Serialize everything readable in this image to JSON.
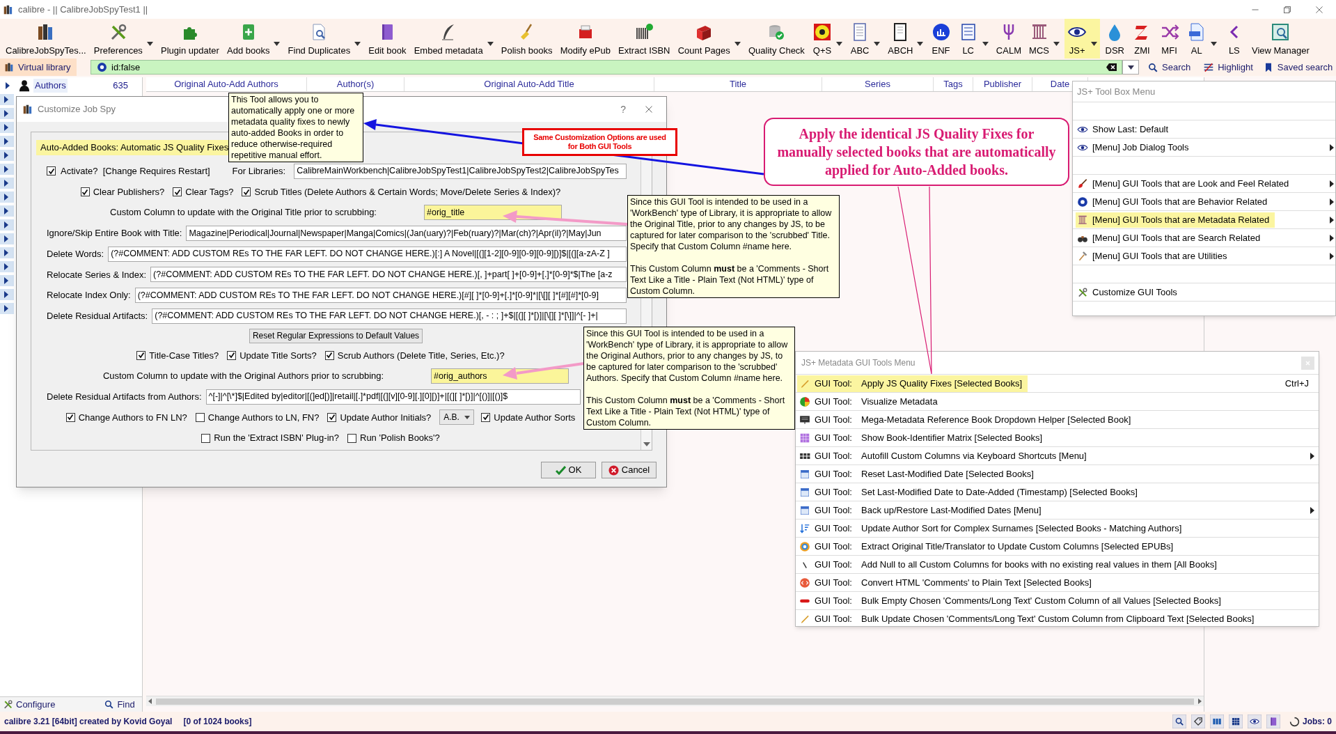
{
  "window": {
    "title": "calibre - || CalibreJobSpyTest1 ||"
  },
  "toolbar": [
    {
      "label": "CalibreJobSpyTes...",
      "dropdown": false,
      "selected": false
    },
    {
      "label": "Preferences",
      "dropdown": true,
      "selected": false
    },
    {
      "label": "Plugin updater",
      "dropdown": false,
      "selected": false
    },
    {
      "label": "Add books",
      "dropdown": true,
      "selected": false
    },
    {
      "label": "Find Duplicates",
      "dropdown": true,
      "selected": false
    },
    {
      "label": "Edit book",
      "dropdown": false,
      "selected": false
    },
    {
      "label": "Embed metadata",
      "dropdown": true,
      "selected": false
    },
    {
      "label": "Polish books",
      "dropdown": false,
      "selected": false
    },
    {
      "label": "Modify ePub",
      "dropdown": false,
      "selected": false
    },
    {
      "label": "Extract ISBN",
      "dropdown": false,
      "selected": false
    },
    {
      "label": "Count Pages",
      "dropdown": true,
      "selected": false
    },
    {
      "label": "Quality Check",
      "dropdown": false,
      "selected": false
    },
    {
      "label": "Q+S",
      "dropdown": true,
      "selected": false
    },
    {
      "label": "ABC",
      "dropdown": true,
      "selected": false
    },
    {
      "label": "ABCH",
      "dropdown": true,
      "selected": false
    },
    {
      "label": "ENF",
      "dropdown": false,
      "selected": false
    },
    {
      "label": "LC",
      "dropdown": true,
      "selected": false
    },
    {
      "label": "CALM",
      "dropdown": false,
      "selected": false
    },
    {
      "label": "MCS",
      "dropdown": true,
      "selected": false
    },
    {
      "label": "JS+",
      "dropdown": true,
      "selected": true
    },
    {
      "label": "DSR",
      "dropdown": false,
      "selected": false
    },
    {
      "label": "ZMI",
      "dropdown": false,
      "selected": false
    },
    {
      "label": "MFI",
      "dropdown": false,
      "selected": false
    },
    {
      "label": "AL",
      "dropdown": true,
      "selected": false
    },
    {
      "label": "LS",
      "dropdown": false,
      "selected": false
    },
    {
      "label": "View Manager",
      "dropdown": false,
      "selected": false
    }
  ],
  "search_bar": {
    "virtual_library": "Virtual library",
    "query": "id:false",
    "search": "Search",
    "highlight": "Highlight",
    "saved_search": "Saved search"
  },
  "tag_browser": {
    "category": "Authors",
    "count": "635",
    "configure": "Configure",
    "find": "Find"
  },
  "table": {
    "columns": [
      "Original Auto-Add Authors",
      "Author(s)",
      "Original Auto-Add Title",
      "Title",
      "Series",
      "Tags",
      "Publisher",
      "Date"
    ]
  },
  "dialog": {
    "title": "Customize Job Spy",
    "help": "?",
    "group_title": "Auto-Added Books: Automatic JS Quality Fixes",
    "rows": [
      {
        "kind": "activate",
        "checked": true,
        "label": "Activate?  [Change Requires Restart]",
        "libraries_label": "For Libraries:",
        "libraries": "CalibreMainWorkbench|CalibreJobSpyTest1|CalibreJobSpyTest2|CalibreJobSpyTes"
      },
      {
        "kind": "checks",
        "items": [
          {
            "kind": "check",
            "label": "Clear Publishers?",
            "checked": true
          },
          {
            "kind": "check",
            "label": "Clear Tags?",
            "checked": true
          },
          {
            "kind": "check",
            "label": "Scrub Titles (Delete Authors & Certain Words; Move/Delete Series & Index)?",
            "checked": true
          }
        ]
      },
      {
        "kind": "custom_column",
        "label": "Custom Column to update with the Original Title prior to scrubbing:",
        "value": "#orig_title"
      },
      {
        "kind": "regex",
        "label": "Ignore/Skip Entire Book with Title:",
        "value": "Magazine|Periodical|Journal|Newspaper|Manga|Comics|(Jan(uary)?|Feb(ruary)?|Mar(ch)?|Apr(il)?|May|Jun"
      },
      {
        "kind": "regex",
        "label": "Delete Words:",
        "value": "(?#COMMENT: ADD CUSTOM REs TO THE FAR LEFT. DO NOT CHANGE HERE.)[:] A Novel|[(][1-2][0-9][0-9][0-9][)]$|[(][a-zA-Z ]"
      },
      {
        "kind": "regex",
        "label": "Relocate Series & Index:",
        "value": "(?#COMMENT: ADD CUSTOM REs TO THE FAR LEFT. DO NOT CHANGE HERE.)[, ]+part[ ]+[0-9]+[.]*[0-9]*$|The [a-z"
      },
      {
        "kind": "regex",
        "label": "Relocate Index Only:",
        "value": "(?#COMMENT: ADD CUSTOM REs TO THE FAR LEFT. DO NOT CHANGE HERE.)[#][ ]*[0-9]+[.]*[0-9]*|[\\[][ ]*[#][#]*[0-9]"
      },
      {
        "kind": "regex",
        "label": "Delete Residual Artifacts:",
        "value": "(?#COMMENT: ADD CUSTOM REs TO THE FAR LEFT. DO NOT CHANGE HERE.)[, - : ; ]+$|[(][ ]*[)]|[\\[][ ]*[\\]]|^[- ]+|"
      },
      {
        "kind": "button",
        "label": "Reset Regular Expressions to Default Values"
      },
      {
        "kind": "checks",
        "items": [
          {
            "kind": "check",
            "label": "Title-Case Titles?",
            "checked": true
          },
          {
            "kind": "check",
            "label": "Update Title Sorts?",
            "checked": true
          },
          {
            "kind": "check",
            "label": "Scrub Authors (Delete Title, Series, Etc.)?",
            "checked": true
          }
        ]
      },
      {
        "kind": "custom_column",
        "label": "Custom Column to update with the Original Authors prior to scrubbing:",
        "value": "#orig_authors"
      },
      {
        "kind": "regex",
        "label": "Delete Residual Artifacts from Authors:",
        "value": "^[-]|^[\\*]$|Edited by|editor|[(]ed[)]|retail|[.]*pdf|[(][v][0-9][.][0][)]+|[(][ ]*[)]|^[()]|[()]$"
      },
      {
        "kind": "checks",
        "items": [
          {
            "kind": "check",
            "label": "Change Authors to FN LN?",
            "checked": true
          },
          {
            "kind": "check",
            "label": "Change Authors to LN, FN?",
            "checked": false
          },
          {
            "kind": "check",
            "label": "Update Author Initials?",
            "checked": true
          },
          {
            "kind": "select",
            "value": "A.B."
          },
          {
            "kind": "check",
            "label": "Update Author Sorts",
            "checked": true
          }
        ]
      },
      {
        "kind": "checks",
        "items": [
          {
            "kind": "check",
            "label": "Run the 'Extract ISBN' Plug-in?",
            "checked": false
          },
          {
            "kind": "check",
            "label": "Run 'Polish Books'?",
            "checked": false
          }
        ]
      }
    ],
    "ok": "OK",
    "cancel": "Cancel"
  },
  "tooltips": [
    {
      "paragraphs": [
        "This Tool allows you to automatically apply one or more metadata quality fixes to newly auto-added Books in order to reduce otherwise-required repetitive manual effort."
      ]
    },
    {
      "paragraphs": [
        "Since this GUI Tool is intended to be used in a 'WorkBench' type of Library, it is appropriate to allow the Original Title, prior to any changes by JS, to be captured for later comparison to the 'scrubbed' Title. Specify that Custom Column #name here.",
        "This Custom Column **must** be a 'Comments - Short Text Like a Title - Plain Text (Not HTML)' type of Custom Column."
      ]
    },
    {
      "paragraphs": [
        "Since this GUI Tool is intended to be used in a 'WorkBench' type of Library, it is appropriate to allow the Original Authors, prior to any changes by JS, to be captured for later comparison to the 'scrubbed' Authors. Specify that Custom Column #name here.",
        "This Custom Column **must** be a 'Comments - Short Text Like a Title - Plain Text (Not HTML)' type of Custom Column."
      ]
    }
  ],
  "notice": {
    "text": "Same Customization Options are used for Both GUI Tools"
  },
  "callout": {
    "text": "Apply the identical JS Quality Fixes for manually selected books that are automatically applied for Auto-Added books."
  },
  "toolbox_menu": {
    "title": "JS+ Tool Box Menu",
    "sections": [
      [
        {
          "label": "Show Last: Default",
          "submenu": false,
          "selected": false
        },
        {
          "label": "[Menu] Job Dialog Tools",
          "submenu": true,
          "selected": false
        }
      ],
      [
        {
          "label": "[Menu] GUI Tools that are Look and Feel Related",
          "submenu": true,
          "selected": false
        },
        {
          "label": "[Menu] GUI Tools that are Behavior Related",
          "submenu": true,
          "selected": false
        },
        {
          "label": "[Menu] GUI Tools that are Metadata Related",
          "submenu": true,
          "selected": true
        },
        {
          "label": "[Menu] GUI Tools that are Search Related",
          "submenu": true,
          "selected": false
        },
        {
          "label": "[Menu] GUI Tools that are Utilities",
          "submenu": true,
          "selected": false
        }
      ],
      [
        {
          "label": "Customize GUI Tools",
          "submenu": false,
          "selected": false
        }
      ]
    ]
  },
  "metadata_menu": {
    "title": "JS+ Metadata GUI Tools Menu",
    "items": [
      {
        "prefix": "GUI Tool:",
        "label": "Apply JS Quality Fixes [Selected Books]",
        "shortcut": "Ctrl+J",
        "submenu": false,
        "selected": true
      },
      {
        "prefix": "GUI Tool:",
        "label": "Visualize Metadata",
        "submenu": false,
        "selected": false
      },
      {
        "prefix": "GUI Tool:",
        "label": "Mega-Metadata Reference Book Dropdown Helper [Selected Book]",
        "submenu": false,
        "selected": false
      },
      {
        "prefix": "GUI Tool:",
        "label": "Show Book-Identifier Matrix [Selected Books]",
        "submenu": false,
        "selected": false
      },
      {
        "prefix": "GUI Tool:",
        "label": "Autofill Custom Columns via Keyboard Shortcuts [Menu]",
        "submenu": true,
        "selected": false
      },
      {
        "prefix": "GUI Tool:",
        "label": "Reset Last-Modified Date [Selected Books]",
        "submenu": false,
        "selected": false
      },
      {
        "prefix": "GUI Tool:",
        "label": "Set Last-Modified Date to Date-Added (Timestamp) [Selected Books]",
        "submenu": false,
        "selected": false
      },
      {
        "prefix": "GUI Tool:",
        "label": "Back up/Restore Last-Modified Dates [Menu]",
        "submenu": true,
        "selected": false
      },
      {
        "prefix": "GUI Tool:",
        "label": "Update Author Sort for Complex Surnames [Selected Books - Matching Authors]",
        "submenu": false,
        "selected": false
      },
      {
        "prefix": "GUI Tool:",
        "label": "Extract Original Title/Translator to Update Custom Columns [Selected EPUBs]",
        "submenu": false,
        "selected": false
      },
      {
        "prefix": "GUI Tool:",
        "label": "Add Null to all Custom Columns for books with no existing real values in them [All Books]",
        "submenu": false,
        "selected": false
      },
      {
        "prefix": "GUI Tool:",
        "label": "Convert HTML 'Comments' to Plain Text [Selected Books]",
        "submenu": false,
        "selected": false
      },
      {
        "prefix": "GUI Tool:",
        "label": "Bulk Empty Chosen 'Comments/Long Text' Custom Column of all Values [Selected Books]",
        "submenu": false,
        "selected": false
      },
      {
        "prefix": "GUI Tool:",
        "label": "Bulk Update Chosen 'Comments/Long Text' Custom Column from Clipboard Text [Selected Books]",
        "submenu": false,
        "selected": false
      }
    ]
  },
  "status_bar": {
    "text": "calibre 3.21 [64bit] created by Kovid Goyal",
    "books": "[0 of 1024 books]",
    "jobs": "Jobs: 0"
  }
}
